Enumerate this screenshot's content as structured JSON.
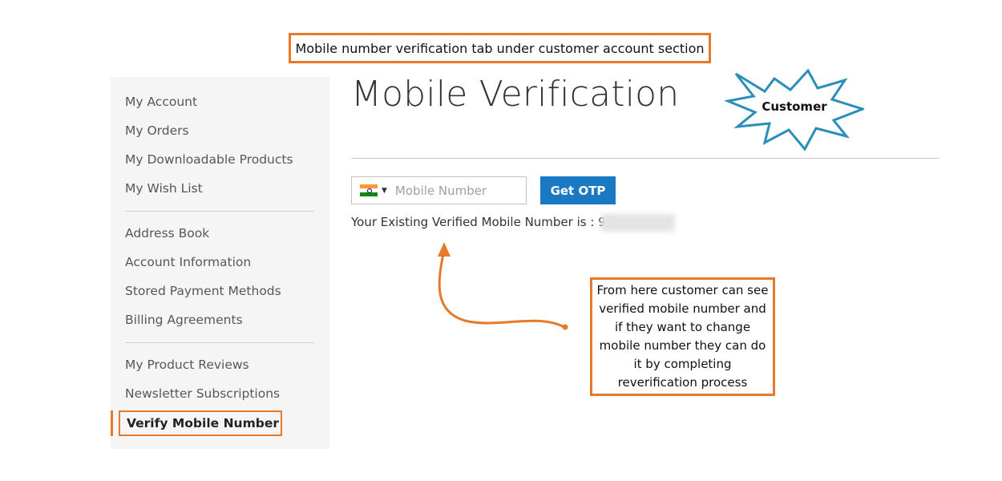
{
  "annotations": {
    "top_callout": "Mobile number verification tab under customer account section",
    "customer_badge": "Customer",
    "note": "From here customer can see verified mobile number and if they want to change mobile number they can do it by completing reverification process"
  },
  "sidebar": {
    "groups": [
      [
        "My Account",
        "My Orders",
        "My Downloadable Products",
        "My Wish List"
      ],
      [
        "Address Book",
        "Account Information",
        "Stored Payment Methods",
        "Billing Agreements"
      ],
      [
        "My Product Reviews",
        "Newsletter Subscriptions"
      ]
    ],
    "active_item": "Verify Mobile Number"
  },
  "main": {
    "title": "Mobile Verification",
    "mobile_input": {
      "placeholder": "Mobile Number",
      "country_flag": "india-flag-icon"
    },
    "get_otp_label": "Get OTP",
    "verified_text": "Your Existing Verified Mobile Number is : 91"
  },
  "colors": {
    "accent_orange": "#e8782a",
    "button_blue": "#1979c3",
    "burst_blue": "#2a8fb8",
    "sidebar_bg": "#f5f5f5"
  }
}
